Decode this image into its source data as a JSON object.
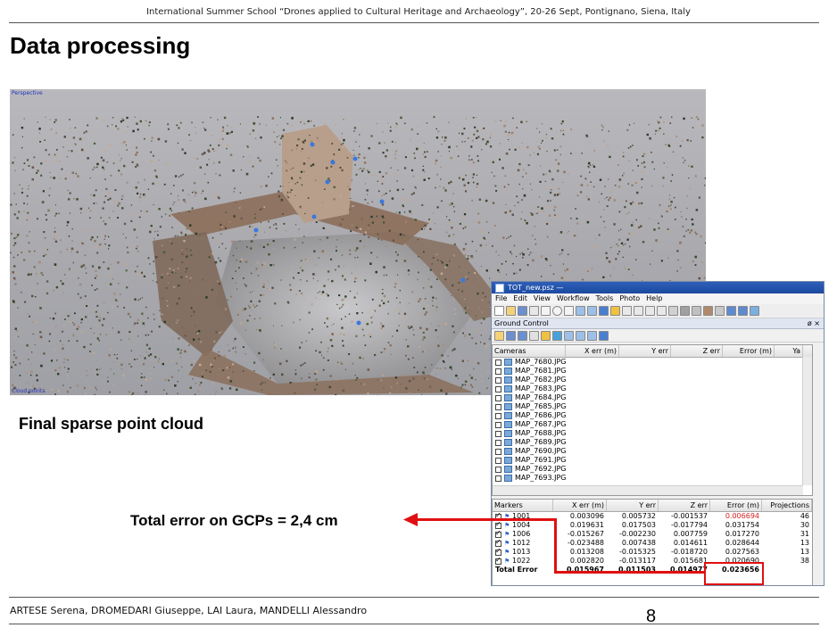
{
  "header": "International Summer School “Drones applied to Cultural Heritage and Archaeology”, 20-26 Sept, Pontignano, Siena, Italy",
  "title": "Data processing",
  "viewport": {
    "corner_label_top": "Perspective",
    "corner_label_bottom": "Cloud points"
  },
  "caption": "Final sparse point cloud",
  "gcp_text": "Total error on GCPs = 2,4 cm",
  "footer": {
    "names": "ARTESE Serena, DROMEDARI Giuseppe, LAI Laura, MANDELLI Alessandro",
    "page": "8"
  },
  "software": {
    "window_title": "TOT_new.psz —",
    "menu": [
      "File",
      "Edit",
      "View",
      "Workflow",
      "Tools",
      "Photo",
      "Help"
    ],
    "panel_title": "Ground Control",
    "panel_close": "ø ×",
    "cameras_headers": [
      "Cameras",
      "X err (m)",
      "Y err",
      "Z err",
      "Error (m)",
      "Ya"
    ],
    "cameras": [
      "MAP_7680.JPG",
      "MAP_7681.JPG",
      "MAP_7682.JPG",
      "MAP_7683.JPG",
      "MAP_7684.JPG",
      "MAP_7685.JPG",
      "MAP_7686.JPG",
      "MAP_7687.JPG",
      "MAP_7688.JPG",
      "MAP_7689.JPG",
      "MAP_7690.JPG",
      "MAP_7691.JPG",
      "MAP_7692.JPG",
      "MAP_7693.JPG"
    ],
    "markers_headers": [
      "Markers",
      "X err (m)",
      "Y err",
      "Z err",
      "Error (m)",
      "Projections"
    ],
    "markers": [
      {
        "id": "1001",
        "x": "0.003096",
        "y": "0.005732",
        "z": "-0.001537",
        "err": "0.006694",
        "proj": "46"
      },
      {
        "id": "1004",
        "x": "0.019631",
        "y": "0.017503",
        "z": "-0.017794",
        "err": "0.031754",
        "proj": "30"
      },
      {
        "id": "1006",
        "x": "-0.015267",
        "y": "-0.002230",
        "z": "0.007759",
        "err": "0.017270",
        "proj": "31"
      },
      {
        "id": "1012",
        "x": "-0.023488",
        "y": "0.007438",
        "z": "0.014611",
        "err": "0.028644",
        "proj": "13"
      },
      {
        "id": "1013",
        "x": "0.013208",
        "y": "-0.015325",
        "z": "-0.018720",
        "err": "0.027563",
        "proj": "13"
      },
      {
        "id": "1022",
        "x": "0.002820",
        "y": "-0.013117",
        "z": "0.015681",
        "err": "0.020690",
        "proj": "38"
      }
    ],
    "total": {
      "label": "Total Error",
      "x": "0.015967",
      "y": "0.011503",
      "z": "0.014977",
      "err": "0.023656",
      "proj": ""
    }
  },
  "colors": {
    "accent_red": "#e01010",
    "title_bar": "#1b49a0"
  }
}
